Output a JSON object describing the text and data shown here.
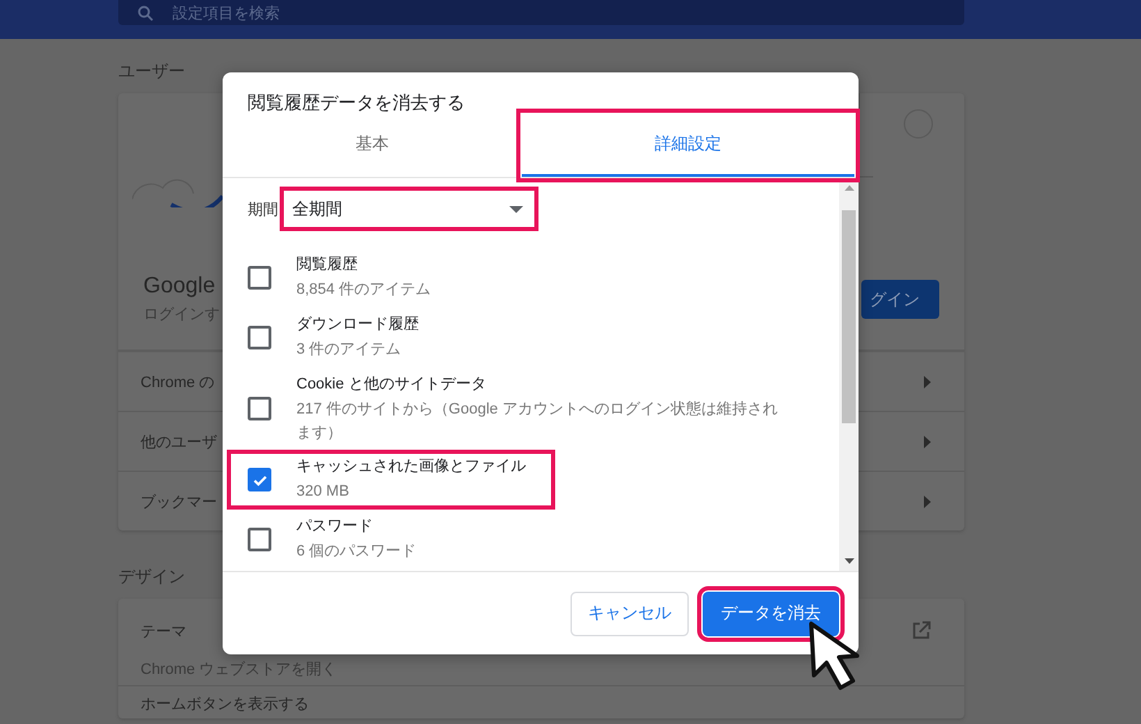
{
  "search": {
    "placeholder": "設定項目を検索"
  },
  "user_section": {
    "heading": "ユーザー",
    "account_title": "Google",
    "account_subtitle": "ログインす",
    "login_button": "グイン",
    "rows": [
      {
        "label": "Chrome の"
      },
      {
        "label": "他のユーザ"
      },
      {
        "label": "ブックマー"
      }
    ]
  },
  "design_section": {
    "heading": "デザイン",
    "rows": [
      {
        "title": "テーマ",
        "subtitle": "Chrome ウェブストアを開く",
        "kind": "external"
      },
      {
        "title": "ホームボタンを表示する",
        "kind": "plain"
      }
    ]
  },
  "dialog": {
    "title": "閲覧履歴データを消去する",
    "tabs": [
      {
        "label": "基本",
        "selected": false,
        "highlighted": false
      },
      {
        "label": "詳細設定",
        "selected": true,
        "highlighted": true
      }
    ],
    "period": {
      "label": "期間",
      "value": "全期間",
      "highlighted": true
    },
    "items": [
      {
        "title": "閲覧履歴",
        "detail": "8,854 件のアイテム",
        "checked": false,
        "highlighted": false
      },
      {
        "title": "ダウンロード履歴",
        "detail": "3 件のアイテム",
        "checked": false,
        "highlighted": false
      },
      {
        "title": "Cookie と他のサイトデータ",
        "detail": "217 件のサイトから（Google アカウントへのログイン状態は維持されます）",
        "checked": false,
        "highlighted": false
      },
      {
        "title": "キャッシュされた画像とファイル",
        "detail": "320 MB",
        "checked": true,
        "highlighted": true
      },
      {
        "title": "パスワード",
        "detail": "6 個のパスワード",
        "checked": false,
        "highlighted": false
      }
    ],
    "buttons": [
      {
        "label": "キャンセル",
        "kind": "secondary",
        "highlighted": false
      },
      {
        "label": "データを消去",
        "kind": "primary",
        "highlighted": true
      }
    ]
  }
}
